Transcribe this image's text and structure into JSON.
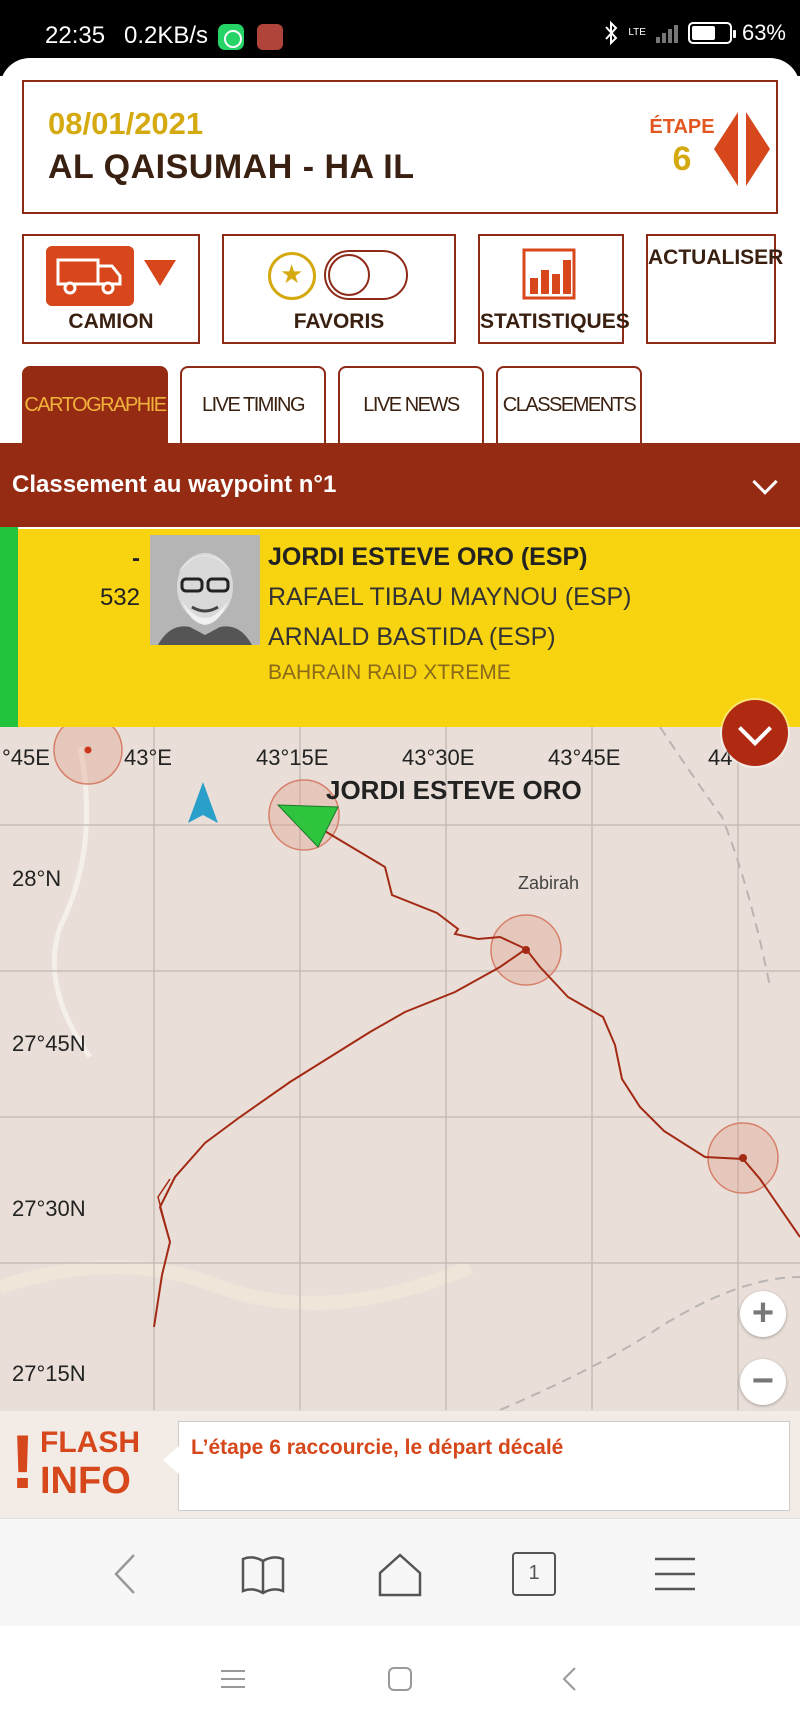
{
  "status_bar": {
    "time": "22:35",
    "speed": "0.2KB/s",
    "network": "LTE",
    "battery": "63%",
    "battery_level": 0.63
  },
  "stage": {
    "date": "08/01/2021",
    "name": "AL QAISUMAH - HA IL",
    "etape_label": "ÉTAPE",
    "etape_number": "6"
  },
  "tools": {
    "camion": "CAMION",
    "favoris": "FAVORIS",
    "statistiques": "STATISTIQUES",
    "actualiser": "ACTUALISER",
    "favoris_toggle_on": false
  },
  "tabs": [
    {
      "label": "CARTOGRAPHIE",
      "active": true
    },
    {
      "label": "LIVE TIMING",
      "active": false
    },
    {
      "label": "LIVE NEWS",
      "active": false
    },
    {
      "label": "CLASSEMENTS",
      "active": false
    }
  ],
  "waypoint": {
    "title": "Classement au waypoint n°1"
  },
  "driver": {
    "rank": "-",
    "number": "532",
    "pilot": "JORDI ESTEVE ORO (ESP)",
    "copilot": "RAFAEL TIBAU MAYNOU (ESP)",
    "mechanic": "ARNALD BASTIDA (ESP)",
    "team": "BAHRAIN RAID XTREME"
  },
  "map": {
    "lon_labels": [
      "°45E",
      "43°E",
      "43°15E",
      "43°30E",
      "43°45E",
      "44"
    ],
    "lat_labels": [
      "28°N",
      "27°45N",
      "27°30N",
      "27°15N"
    ],
    "driver_label": "JORDI ESTEVE ORO",
    "city": "Zabirah",
    "zoom_in": "+",
    "zoom_out": "−",
    "route_color": "#a32a14"
  },
  "flash": {
    "word1": "FLASH",
    "word2": "INFO",
    "bang": "!",
    "message": "L’étape 6 raccourcie, le départ décalé"
  },
  "browser": {
    "tab_count": "1"
  }
}
